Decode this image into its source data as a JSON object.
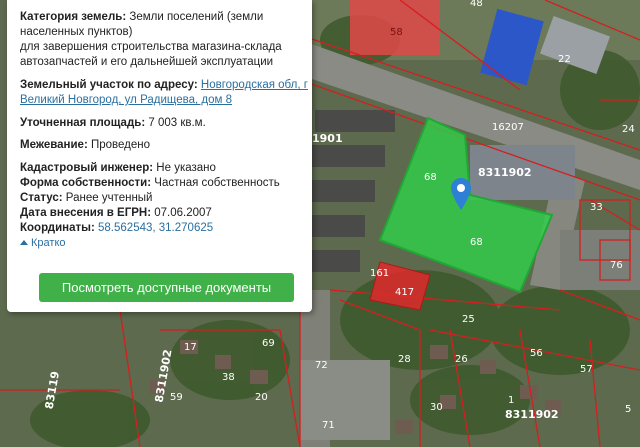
{
  "card": {
    "category_label": "Категория земель:",
    "category_value": "Земли поселений (земли населенных пунктов)",
    "purpose": "для завершения строительства магазина-склада автозапчастей и его дальнейшей эксплуатации",
    "address_label": "Земельный участок по адресу:",
    "address_link": "Новгородская обл, г Великий Новгород, ул Радищева, дом 8",
    "area_label": "Уточненная площадь:",
    "area_value": "7 003 кв.м.",
    "survey_label": "Межевание:",
    "survey_value": "Проведено",
    "engineer_label": "Кадастровый инженер:",
    "engineer_value": "Не указано",
    "ownership_label": "Форма собственности:",
    "ownership_value": "Частная собственность",
    "status_label": "Статус:",
    "status_value": "Ранее учтенный",
    "date_label": "Дата внесения в ЕГРН:",
    "date_value": "07.06.2007",
    "coords_label": "Координаты:",
    "coords_value": "58.562543, 31.270625",
    "toggle_label": "Кратко",
    "button_label": "Посмотреть доступные документы"
  },
  "map": {
    "labels": {
      "l58": "58",
      "l48": "48",
      "l22": "22",
      "l24": "24",
      "l16207": "16207",
      "l1901": "1901",
      "l8311902": "8311902",
      "l68a": "68",
      "l68b": "68",
      "l33": "33",
      "l161": "161",
      "l417": "417",
      "l25": "25",
      "l76": "76",
      "l72": "72",
      "l28": "28",
      "l26": "26",
      "l56": "56",
      "l57": "57",
      "l69": "69",
      "l20": "20",
      "l17": "17",
      "l8311902b": "8311902",
      "l83119": "83119",
      "l38": "38",
      "l30": "30",
      "l71": "71",
      "l1": "1",
      "l8311902c": "8311902",
      "l59": "59",
      "l5": "5"
    },
    "colors": {
      "parcel_green": "#2fd14a",
      "parcel_red": "#e02a2a",
      "boundary": "#d41f1f"
    }
  }
}
